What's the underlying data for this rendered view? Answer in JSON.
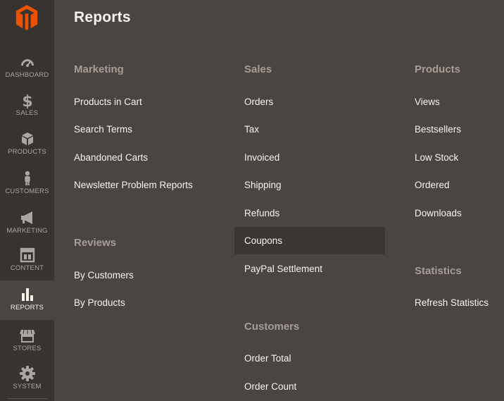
{
  "sidebar": {
    "logo_icon": "magento-logo-icon",
    "items": [
      {
        "label": "DASHBOARD",
        "icon": "speedometer-icon"
      },
      {
        "label": "SALES",
        "icon": "dollar-icon"
      },
      {
        "label": "PRODUCTS",
        "icon": "cube-icon"
      },
      {
        "label": "CUSTOMERS",
        "icon": "person-icon"
      },
      {
        "label": "MARKETING",
        "icon": "megaphone-icon"
      },
      {
        "label": "CONTENT",
        "icon": "layout-icon"
      },
      {
        "label": "REPORTS",
        "icon": "bar-chart-icon",
        "active": true
      },
      {
        "label": "STORES",
        "icon": "storefront-icon"
      },
      {
        "label": "SYSTEM",
        "icon": "gear-icon"
      }
    ]
  },
  "page": {
    "title": "Reports"
  },
  "columns": {
    "marketing": {
      "heading": "Marketing",
      "items": [
        "Products in Cart",
        "Search Terms",
        "Abandoned Carts",
        "Newsletter Problem Reports"
      ]
    },
    "reviews": {
      "heading": "Reviews",
      "items": [
        "By Customers",
        "By Products"
      ]
    },
    "sales": {
      "heading": "Sales",
      "items": [
        "Orders",
        "Tax",
        "Invoiced",
        "Shipping",
        "Refunds",
        "Coupons",
        "PayPal Settlement"
      ],
      "hovered_item": "Coupons"
    },
    "customers": {
      "heading": "Customers",
      "items": [
        "Order Total",
        "Order Count"
      ]
    },
    "products": {
      "heading": "Products",
      "items": [
        "Views",
        "Bestsellers",
        "Low Stock",
        "Ordered",
        "Downloads"
      ]
    },
    "statistics": {
      "heading": "Statistics",
      "items": [
        "Refresh Statistics"
      ]
    }
  },
  "colors": {
    "sidebar_bg": "#373330",
    "panel_bg": "#4a4542",
    "brand_orange": "#eb5202",
    "heading_text": "#a79d95",
    "link_text": "#f7f3eb"
  }
}
